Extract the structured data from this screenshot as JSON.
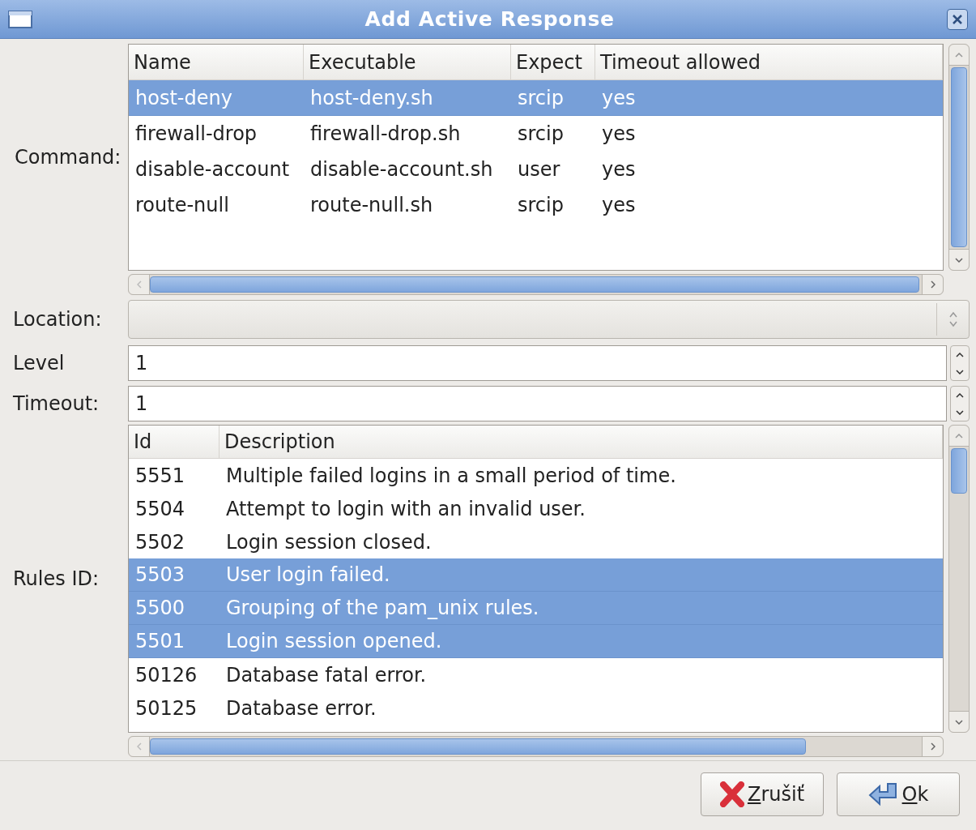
{
  "window": {
    "title": "Add Active Response"
  },
  "command": {
    "label": "Command:",
    "columns": [
      "Name",
      "Executable",
      "Expect",
      "Timeout allowed"
    ],
    "rows": [
      {
        "cells": [
          "host-deny",
          "host-deny.sh",
          "srcip",
          "yes"
        ],
        "selected": true
      },
      {
        "cells": [
          "firewall-drop",
          "firewall-drop.sh",
          "srcip",
          "yes"
        ],
        "selected": false
      },
      {
        "cells": [
          "disable-account",
          "disable-account.sh",
          "user",
          "yes"
        ],
        "selected": false
      },
      {
        "cells": [
          "route-null",
          "route-null.sh",
          "srcip",
          "yes"
        ],
        "selected": false
      }
    ]
  },
  "location": {
    "label": "Location:"
  },
  "level": {
    "label": "Level",
    "value": "1"
  },
  "timeout": {
    "label": "Timeout:",
    "value": "1"
  },
  "rules": {
    "label": "Rules ID:",
    "columns": [
      "Id",
      "Description"
    ],
    "rows": [
      {
        "cells": [
          "5551",
          "Multiple failed logins in a small period of time."
        ],
        "selected": false
      },
      {
        "cells": [
          "5504",
          "Attempt to login with an invalid user."
        ],
        "selected": false
      },
      {
        "cells": [
          "5502",
          "Login session closed."
        ],
        "selected": false
      },
      {
        "cells": [
          "5503",
          "User login failed."
        ],
        "selected": true
      },
      {
        "cells": [
          "5500",
          "Grouping of the pam_unix rules."
        ],
        "selected": true
      },
      {
        "cells": [
          "5501",
          "Login session opened."
        ],
        "selected": true
      },
      {
        "cells": [
          "50126",
          "Database fatal error."
        ],
        "selected": false
      },
      {
        "cells": [
          "50125",
          "Database error."
        ],
        "selected": false
      }
    ]
  },
  "buttons": [
    {
      "kind": "cancel",
      "label": "Zrušiť"
    },
    {
      "kind": "ok",
      "label": "Ok"
    }
  ]
}
